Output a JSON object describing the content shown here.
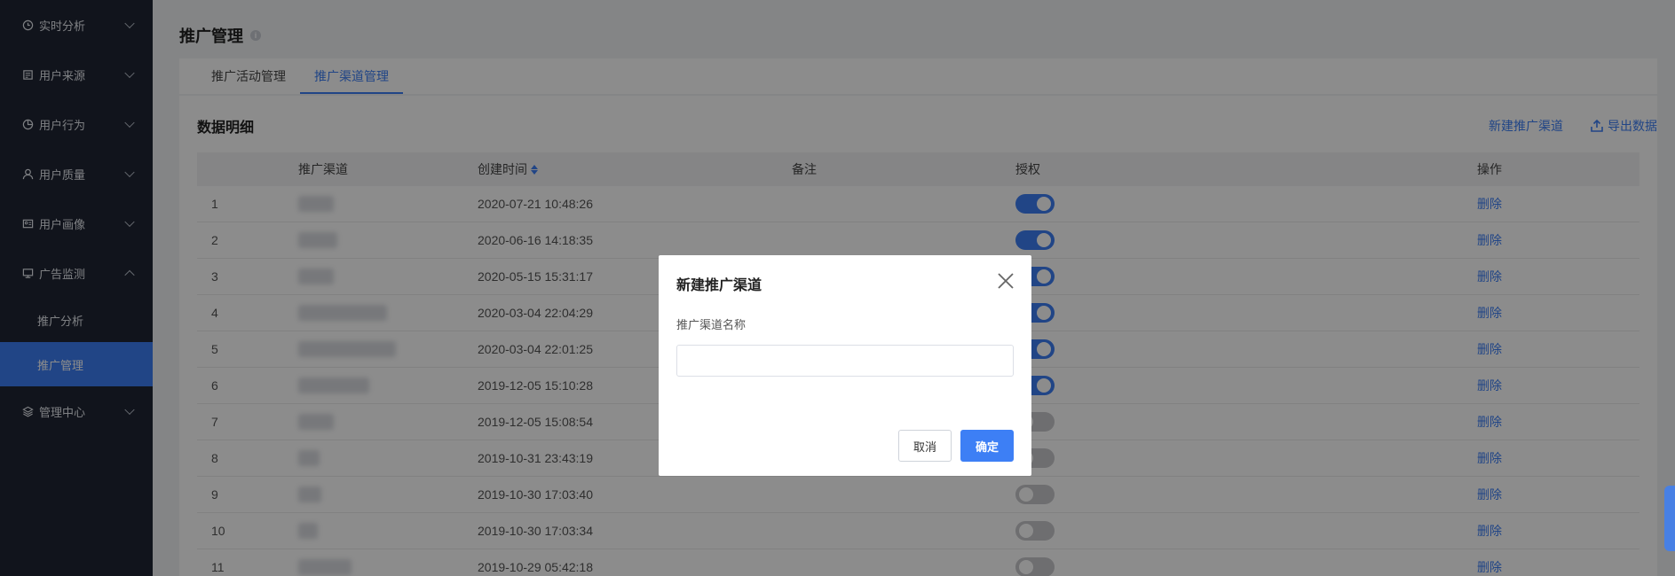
{
  "sidebar": {
    "items": [
      {
        "label": "实时分析",
        "icon": "clock-icon",
        "expanded": false
      },
      {
        "label": "用户来源",
        "icon": "document-icon",
        "expanded": false
      },
      {
        "label": "用户行为",
        "icon": "pie-chart-icon",
        "expanded": false
      },
      {
        "label": "用户质量",
        "icon": "user-icon",
        "expanded": false
      },
      {
        "label": "用户画像",
        "icon": "id-card-icon",
        "expanded": false
      },
      {
        "label": "广告监测",
        "icon": "monitor-icon",
        "expanded": true
      },
      {
        "label": "管理中心",
        "icon": "layers-icon",
        "expanded": false
      }
    ],
    "sub_items": [
      {
        "label": "推广分析",
        "active": false
      },
      {
        "label": "推广管理",
        "active": true
      }
    ]
  },
  "page": {
    "title": "推广管理"
  },
  "tabs": [
    {
      "label": "推广活动管理",
      "active": false
    },
    {
      "label": "推广渠道管理",
      "active": true
    }
  ],
  "section": {
    "title": "数据明细",
    "new_channel": "新建推广渠道",
    "export": "导出数据"
  },
  "table": {
    "headers": [
      "推广渠道",
      "创建时间",
      "备注",
      "授权",
      "操作"
    ],
    "rows": [
      {
        "id": "1",
        "time": "2020-07-21 10:48:26",
        "auth": true,
        "action": "删除"
      },
      {
        "id": "2",
        "time": "2020-06-16 14:18:35",
        "auth": true,
        "action": "删除"
      },
      {
        "id": "3",
        "time": "2020-05-15 15:31:17",
        "auth": true,
        "action": "删除"
      },
      {
        "id": "4",
        "time": "2020-03-04 22:04:29",
        "auth": true,
        "action": "删除"
      },
      {
        "id": "5",
        "time": "2020-03-04 22:01:25",
        "auth": true,
        "action": "删除"
      },
      {
        "id": "6",
        "time": "2019-12-05 15:10:28",
        "auth": true,
        "action": "删除"
      },
      {
        "id": "7",
        "time": "2019-12-05 15:08:54",
        "auth": false,
        "action": "删除"
      },
      {
        "id": "8",
        "time": "2019-10-31 23:43:19",
        "auth": false,
        "action": "删除"
      },
      {
        "id": "9",
        "time": "2019-10-30 17:03:40",
        "auth": false,
        "action": "删除"
      },
      {
        "id": "10",
        "time": "2019-10-30 17:03:34",
        "auth": false,
        "action": "删除"
      },
      {
        "id": "11",
        "time": "2019-10-29 05:42:18",
        "auth": false,
        "action": "删除"
      }
    ]
  },
  "modal": {
    "title": "新建推广渠道",
    "field_label": "推广渠道名称",
    "field_value": "",
    "cancel": "取消",
    "confirm": "确定"
  },
  "colors": {
    "accent": "#3d7ff5",
    "sidebar_bg": "#1f2533"
  }
}
